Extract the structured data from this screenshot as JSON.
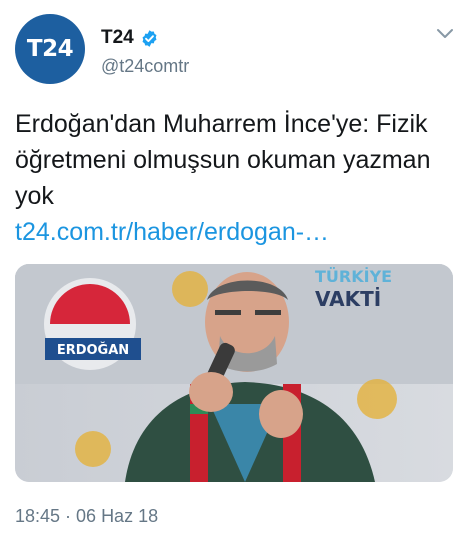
{
  "account": {
    "avatar_text": "T24",
    "display_name": "T24",
    "handle": "@t24comtr",
    "verified": true
  },
  "tweet": {
    "text": "Erdoğan'dan Muharrem İnce'ye: Fizik öğretmeni olmuşsun okuman yazman yok",
    "link": "t24.com.tr/haber/erdogan-…"
  },
  "media": {
    "banner_logo_text": "ERDOĞAN",
    "banner_text_1": "TÜRKİYE",
    "banner_text_2": "VAKTİ"
  },
  "meta": {
    "timestamp": "18:45 · 06 Haz 18"
  },
  "colors": {
    "brand_blue": "#1d5fa0",
    "link": "#1b95e0",
    "muted": "#657786",
    "verified": "#1da1f2"
  },
  "icons": [
    "verified-icon",
    "chevron-down-icon"
  ]
}
